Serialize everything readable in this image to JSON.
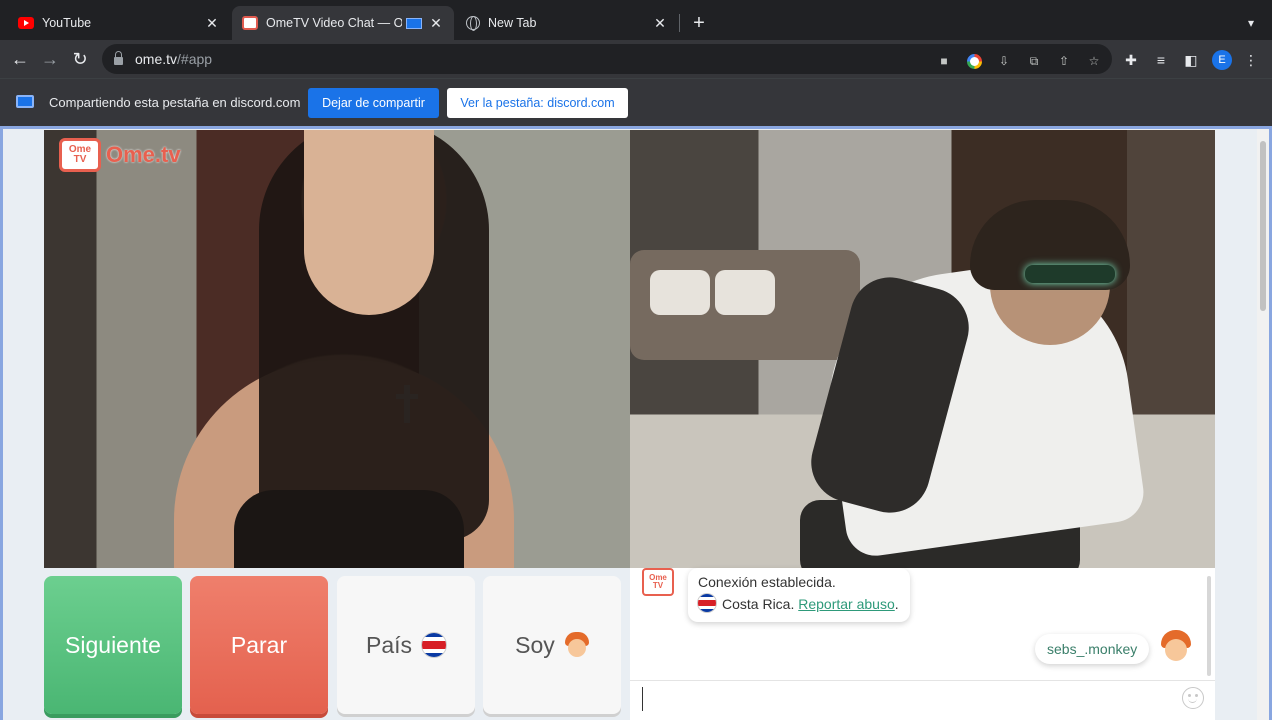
{
  "tabs": [
    {
      "label": "YouTube",
      "icon": "youtube-icon"
    },
    {
      "label": "OmeTV Video Chat — Ome",
      "icon": "ometv-icon",
      "active": true
    },
    {
      "label": "New Tab",
      "icon": "globe-icon"
    }
  ],
  "toolbar": {
    "url_host": "ome.tv",
    "url_path": "/#app",
    "profile_initial": "E"
  },
  "infobar": {
    "message": "Compartiendo esta pestaña en discord.com",
    "stop_label": "Dejar de compartir",
    "view_label": "Ver la pestaña: discord.com"
  },
  "app": {
    "logo_box": "Ome TV",
    "logo_word": "Ome.tv",
    "controls": {
      "next": "Siguiente",
      "stop": "Parar",
      "country": "País",
      "gender": "Soy"
    },
    "chat": {
      "sys_logo": "Ome TV",
      "status": "Conexión establecida.",
      "country": "Costa Rica.",
      "report": "Reportar abuso",
      "report_suffix": ".",
      "username": "sebs_.monkey",
      "input_value": ""
    }
  },
  "colors": {
    "brand": "#e8604f",
    "next": "#4ab673",
    "stop": "#e4614e",
    "link": "#2e9a7a",
    "share_accent": "#1a73e8"
  }
}
